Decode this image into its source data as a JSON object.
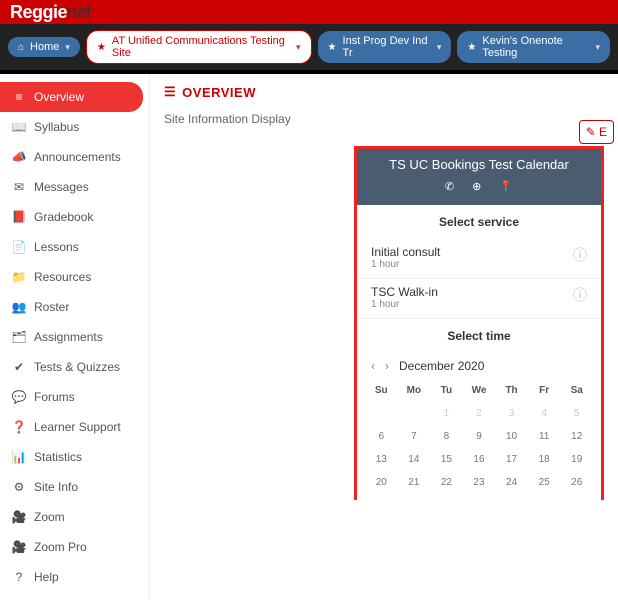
{
  "brand": {
    "primary": "Reggie",
    "suffix": "net"
  },
  "nav": {
    "home": "Home",
    "site_active": "AT Unified Communications Testing Site",
    "site2": "Inst Prog Dev Ind Tr",
    "site3": "Kevin's Onenote Testing"
  },
  "sidebar": {
    "items": [
      {
        "label": "Overview",
        "icon": "≡"
      },
      {
        "label": "Syllabus",
        "icon": "📖"
      },
      {
        "label": "Announcements",
        "icon": "📣"
      },
      {
        "label": "Messages",
        "icon": "✉"
      },
      {
        "label": "Gradebook",
        "icon": "📕"
      },
      {
        "label": "Lessons",
        "icon": "📄"
      },
      {
        "label": "Resources",
        "icon": "📁"
      },
      {
        "label": "Roster",
        "icon": "👥"
      },
      {
        "label": "Assignments",
        "icon": "🗂"
      },
      {
        "label": "Tests & Quizzes",
        "icon": "✔"
      },
      {
        "label": "Forums",
        "icon": "💬"
      },
      {
        "label": "Learner Support",
        "icon": "❓"
      },
      {
        "label": "Statistics",
        "icon": "📊"
      },
      {
        "label": "Site Info",
        "icon": "⚙"
      },
      {
        "label": "Zoom",
        "icon": "🎥"
      },
      {
        "label": "Zoom Pro",
        "icon": "🎥"
      },
      {
        "label": "Help",
        "icon": "?"
      }
    ]
  },
  "page": {
    "title": "OVERVIEW",
    "info_label": "Site Information Display",
    "edit_label": "E"
  },
  "booking": {
    "title": "TS UC Bookings Test Calendar",
    "select_service": "Select service",
    "select_time": "Select time",
    "services": [
      {
        "name": "Initial consult",
        "duration": "1 hour"
      },
      {
        "name": "TSC Walk-in",
        "duration": "1 hour"
      }
    ],
    "calendar": {
      "month": "December 2020",
      "dow": [
        "Su",
        "Mo",
        "Tu",
        "We",
        "Th",
        "Fr",
        "Sa"
      ],
      "weeks": [
        [
          "",
          "",
          "1",
          "2",
          "3",
          "4",
          "5"
        ],
        [
          "6",
          "7",
          "8",
          "9",
          "10",
          "11",
          "12"
        ],
        [
          "13",
          "14",
          "15",
          "16",
          "17",
          "18",
          "19"
        ],
        [
          "20",
          "21",
          "22",
          "23",
          "24",
          "25",
          "26"
        ]
      ]
    }
  }
}
